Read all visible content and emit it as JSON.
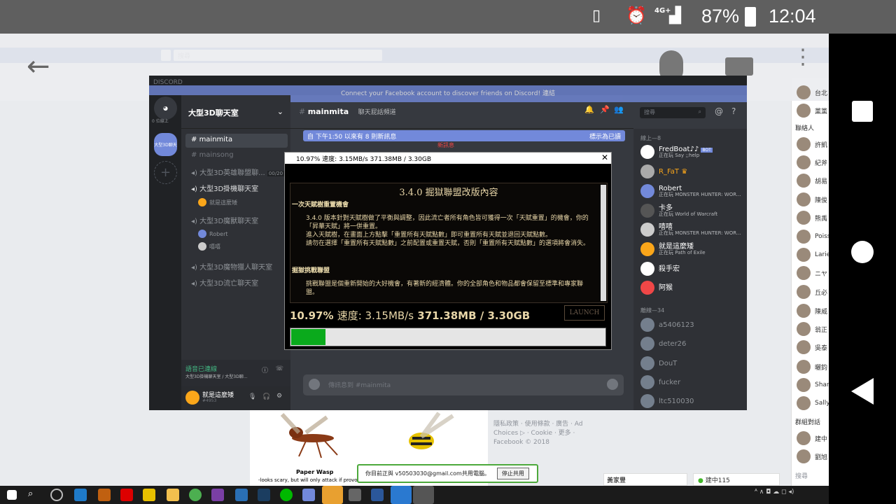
{
  "android": {
    "battery": "87%",
    "clock": "12:04",
    "signal": "4G+"
  },
  "facebook": {
    "search_placeholder": "搜尋",
    "connect_bar": "Connect your Facebook account to discover friends on Discord!",
    "connect_btn": "連結",
    "friends": [
      "台北",
      "黨黨",
      "聯絡人",
      "許凱",
      "紀斧",
      "胡易",
      "陳俊",
      "熊禹",
      "Poiss",
      "Larie",
      "ニヤ",
      "丘必",
      "陳威",
      "翁正",
      "吳泰",
      "曬鈞",
      "Shar",
      "Sally",
      "群組對話",
      "建中",
      "劉旭"
    ],
    "footer": "隱私政策 · 使用條款 · 廣告 · Ad Choices ▷ · Cookie · 更多 ·",
    "copyright": "Facebook © 2018",
    "paper_wasp": "Paper Wasp",
    "wasp_text": "-looks scary, but will only attack if provoke",
    "bottom_name": "黃家豐",
    "bottom_chat": "建中115",
    "search_bottom": "搜尋"
  },
  "share": {
    "text": "你目前正與 v50503030@gmail.com共用電腦。",
    "stop": "停止共用"
  },
  "discord": {
    "title": "DISCORD",
    "server": "大型3D聊天室",
    "guild_label": "大型3D聊天",
    "online_label": "0 位線上",
    "channels": [
      {
        "name": "mainmita",
        "sel": true
      },
      {
        "name": "mainsong",
        "sel": false
      }
    ],
    "voice_channels": [
      "大型3D英雄聯盟聊...",
      "大型3D掛機聊天室",
      "大型3D魔獸聊天室",
      "大型3D魔物獵人聊天室",
      "大型3D流亡聊天室"
    ],
    "voice_count": "00/20",
    "voice_users_a": [
      "就是這麼矮"
    ],
    "voice_users_b": [
      "Robert",
      "嘻嘻"
    ],
    "vconnect": "語音已連線",
    "vconnect_sub": "大型3D掛機聊天室 / 大型3D聊...",
    "user": "就是這麼矮",
    "user_tag": "#4953",
    "channel_header": "mainmita",
    "channel_topic": "聊天屁話頻道",
    "search": "搜尋",
    "newbar": "自 下午1:50 以來有 8 則新訊息",
    "newbar_right": "標示為已讀",
    "new_divider": "新訊息",
    "input_placeholder": "傳訊息到 #mainmita",
    "online_hdr": "線上—8",
    "offline_hdr": "離線—34",
    "members": [
      {
        "name": "FredBoat♪♪",
        "sub": "正在玩 Say ;;help",
        "bot": "BOT"
      },
      {
        "name": "R_FaT",
        "sub": ""
      },
      {
        "name": "Robert",
        "sub": "正在玩 MONSTER HUNTER: WOR..."
      },
      {
        "name": "卡多",
        "sub": "正在玩 World of Warcraft"
      },
      {
        "name": "嘻嘻",
        "sub": "正在玩 MONSTER HUNTER: WOR..."
      },
      {
        "name": "就是這麼矮",
        "sub": "正在玩 Path of Exile"
      },
      {
        "name": "殺手宏",
        "sub": ""
      },
      {
        "name": "阿猴",
        "sub": ""
      }
    ],
    "offline": [
      "a5406123",
      "deter26",
      "DouT",
      "fucker",
      "ltc510030"
    ]
  },
  "patcher": {
    "title": "10.97%  速度: 3.15MB/s  371.38MB / 3.30GB",
    "heading": "3.4.0 掘獄聯盟改版內容",
    "section1": "一次天賦樹重置機會",
    "p1": "3.4.0 版本針對天賦樹做了平衡與調整，因此流亡者所有角色皆可獲得一次「天賦重置」的機會，你的「昇華天賦」將一併重置。",
    "p2": "進入天賦樹，在畫面上方點擊「重置所有天賦點數」即可重置所有天賦並退回天賦點數。",
    "p3": "請勿在選擇「重置所有天賦點數」之前配置或重置天賦，否則「重置所有天賦點數」的選項將會消失。",
    "section2": "掘獄挑戰聯盟",
    "p4": "挑戰聯盟是個重新開始的大好機會，有著新的經濟體。你的全部角色和物品都會保留至標準和專家聯盟。",
    "percent": "10.97%",
    "speed": "速度: 3.15MB/s",
    "size": "371.38MB / 3.30GB",
    "progress": 0.1097,
    "launch": "LAUNCH"
  }
}
